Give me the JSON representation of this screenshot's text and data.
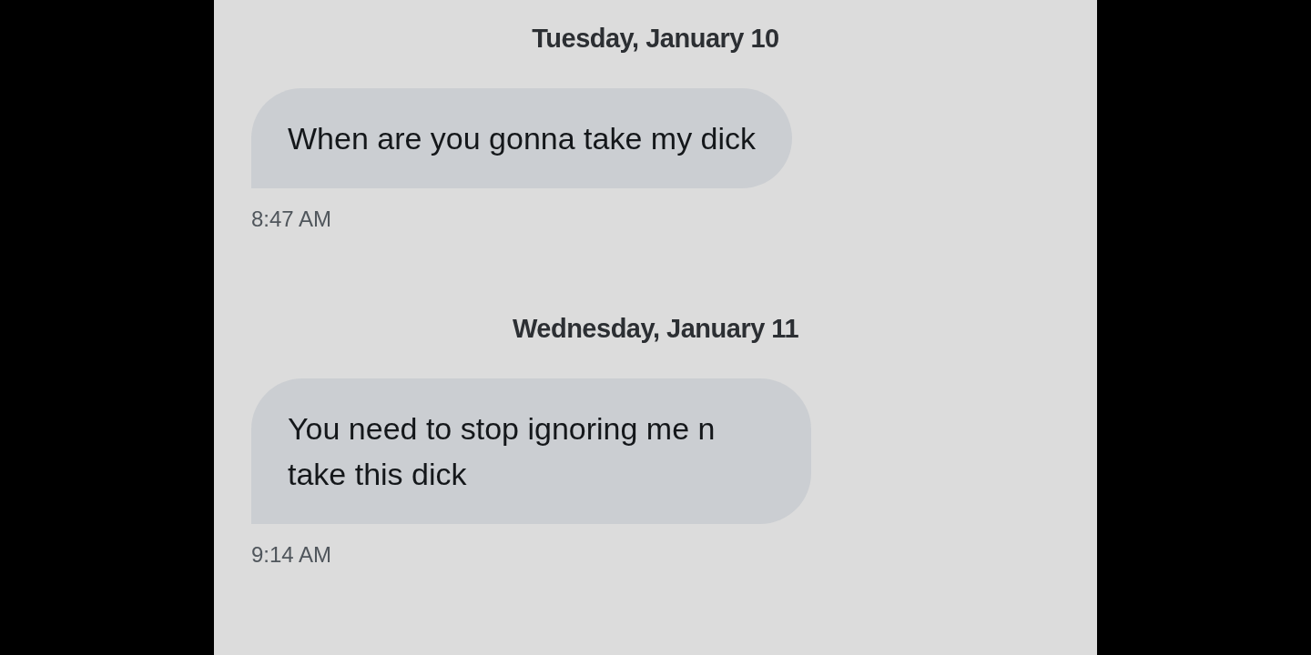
{
  "conversation": [
    {
      "date": "Tuesday, January 10",
      "message": "When are you gonna take my dick",
      "time": "8:47 AM"
    },
    {
      "date": "Wednesday, January 11",
      "message": "You need to stop ignoring me n take this dick",
      "time": "9:14 AM"
    }
  ]
}
